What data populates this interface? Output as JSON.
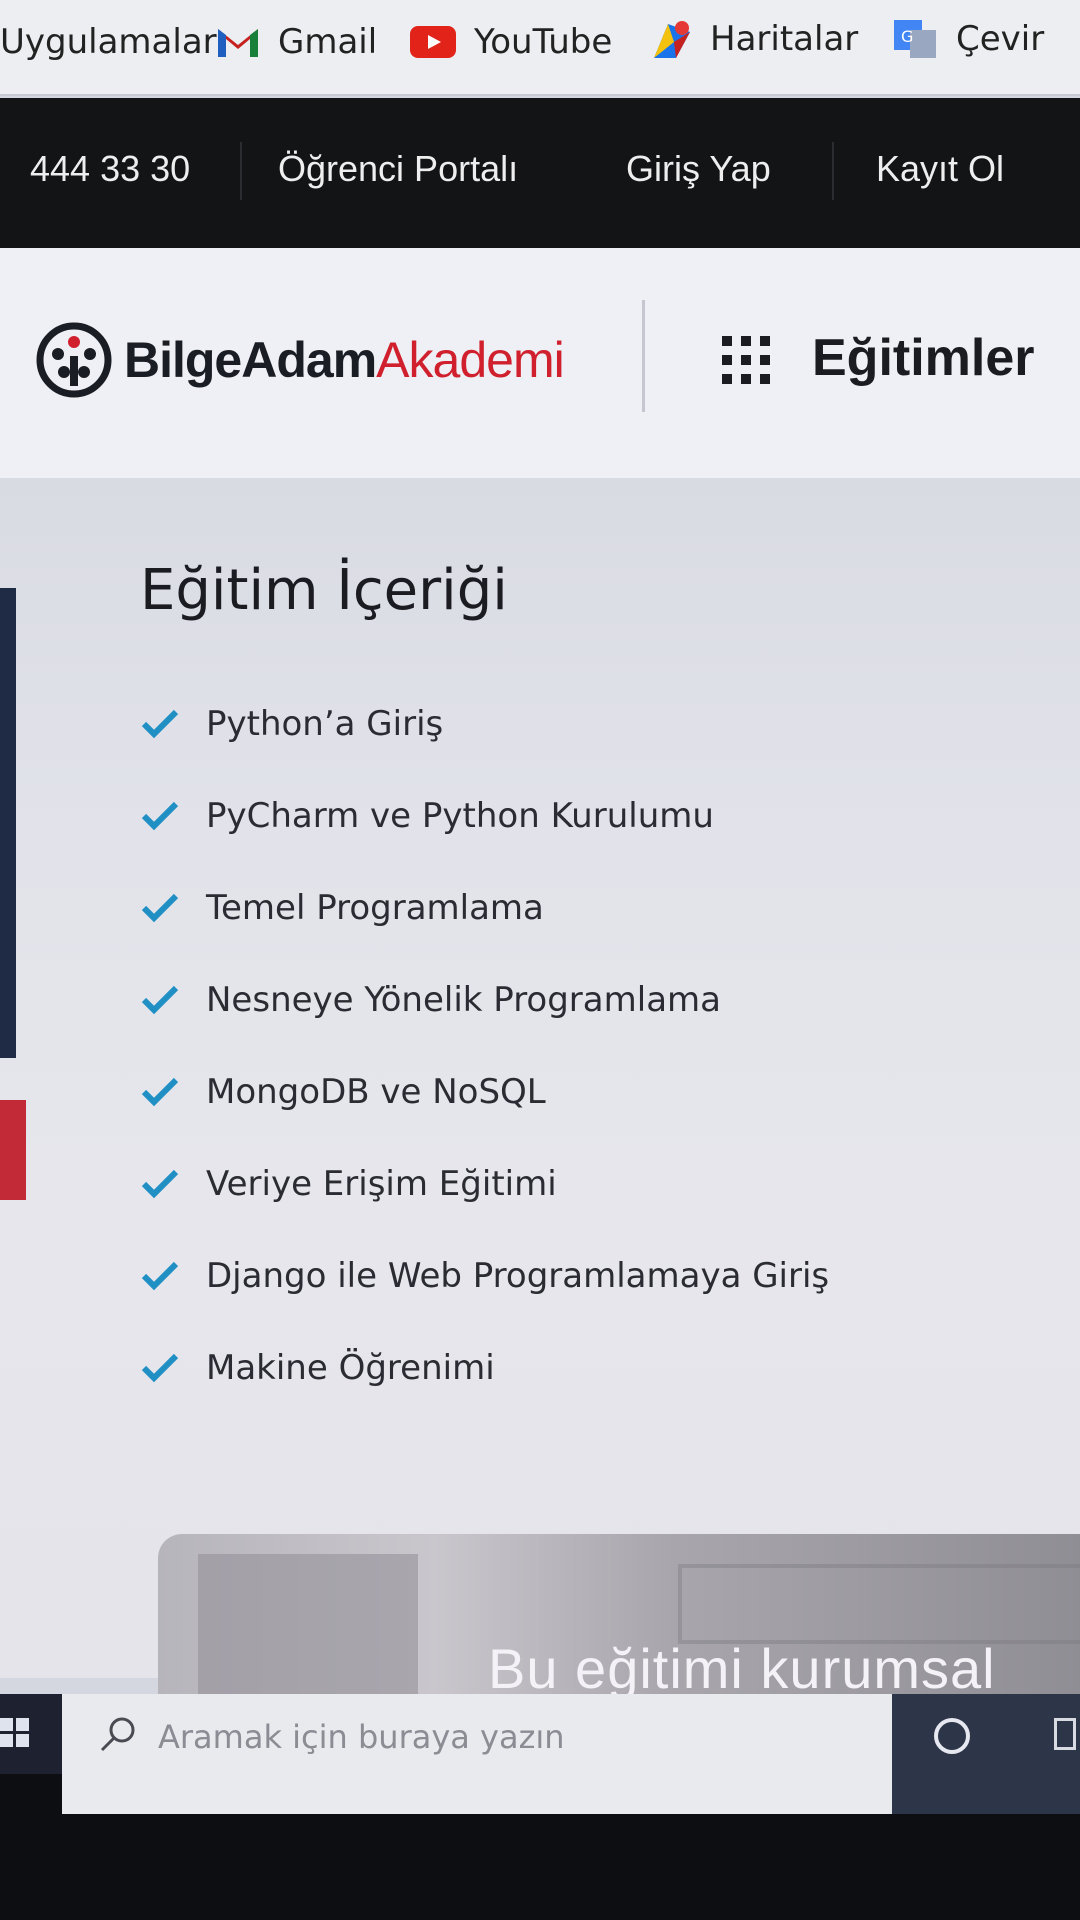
{
  "bookmarks": {
    "apps": "Uygulamalar",
    "gmail": "Gmail",
    "youtube": "YouTube",
    "maps": "Haritalar",
    "translate": "Çevir"
  },
  "topnav": {
    "phone": "444 33 30",
    "student_portal": "Öğrenci Portalı",
    "login": "Giriş Yap",
    "register": "Kayıt Ol"
  },
  "header": {
    "logo_primary": "BilgeAdam",
    "logo_secondary": "Akademi",
    "menu_label": "Eğitimler"
  },
  "content": {
    "title": "Eğitim İçeriği",
    "items": [
      "Python’a Giriş",
      "PyCharm ve Python Kurulumu",
      "Temel Programlama",
      "Nesneye Yönelik Programlama",
      "MongoDB ve NoSQL",
      "Veriye Erişim Eğitimi",
      "Django ile Web Programlamaya Giriş",
      "Makine Öğrenimi"
    ]
  },
  "banner": {
    "text": "Bu eğitimi kurumsal"
  },
  "taskbar": {
    "search_placeholder": "Aramak için buraya yazın"
  },
  "colors": {
    "brand_red": "#d0202e",
    "brand_dark": "#1a1d24",
    "check_blue": "#1f8fc4",
    "topnav_bg": "#131416"
  }
}
